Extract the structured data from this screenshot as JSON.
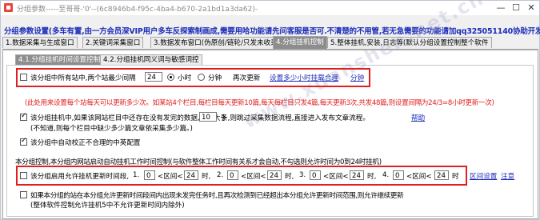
{
  "window": {
    "title": "分组参数-----至哥哥-'0'--(6c8946b4-f95c-4ba4-b670-2a1bd1a3da62)-",
    "buttons": {
      "minimize": "—",
      "maximize": "☐",
      "close": "✕"
    }
  },
  "banner": "分组参数设置(多车有置,由一方会员深VIP用户多车反探索制画成,需要用哈功能请先问客服是否可.不清楚的不用管,若无急需要的功能请加qq325051140协助开发)",
  "tabs_main": [
    {
      "label": "1.数据采集与生成窗口"
    },
    {
      "label": "2.关键词采集窗口"
    },
    {
      "label": "3.数据发布窗口(伪原创/链轮/只发未收录"
    },
    {
      "label": "4.分组挂机控制"
    },
    {
      "label": "5.整体挂机,安装,日志等(默认分组设置控制整个软件"
    }
  ],
  "tabs_sub": [
    {
      "label": "4.1.分组挂机时间设置控制"
    },
    {
      "label": "4.2.分组挂机同义词与敏感词控"
    }
  ],
  "row1": {
    "label": "该分组中所有站中,两个站最少间隔",
    "interval_value": "24",
    "radio_hour": "小时",
    "radio_minute": "分钟",
    "update_text": "再次更新",
    "link_set": "设置多少小时挂载合理",
    "link_minute": "分钟"
  },
  "red_note": "(此处用来设置每个站每天可以更新多少次。如某站4个栏目,每栏目每天更新10篇,每天每栏目只发4篇,每天更新3次,共发48篇,则设置间隔为24/3=8小时更新一次)",
  "row2": {
    "label": "该分组挂机中,如果该网站栏目中还存在没有发完的数据,当数大于",
    "count_value": "10",
    "label2": "条,则跳过采集数据流程,直接进入发布文章流程。",
    "help_link": "帮助",
    "note": "(不知道,则每个栏目中缺少多少篇文章依采集多少篇。)"
  },
  "row3": {
    "label": "该分组中自动校正不合理的中英配置"
  },
  "schedule_title": "本分组控制,本分组内网站启动自动挂机工作时间控制(与软件整体工作时间有关系才会自动,不勾选则允许时间为0到24时挂机)",
  "row4": {
    "label": "该分组启用允许挂机更新时间段,",
    "ranges": [
      {
        "index": "1.",
        "from": "0",
        "between": "<区间<",
        "to": "24",
        "unit": "时,"
      },
      {
        "index": "2.",
        "from": "0",
        "between": "<区间<",
        "to": "24",
        "unit": "时,"
      },
      {
        "index": "3.",
        "from": "0",
        "between": "<区间<",
        "to": "24",
        "unit": "时,"
      },
      {
        "index": "4.",
        "from": "0",
        "between": "<区间<",
        "to": "24",
        "unit": "时"
      }
    ],
    "link_reset": "区间设置",
    "link_note": "注意"
  },
  "row5": {
    "label": "如果本分组的站在本分组允许更新时间段间内出现未发完任务时,且再次检测到已经超出本分组允许更新时间范围,则允许继续更新",
    "note": "(整体软件控制允许挂机5中不允许更新时间内除外)"
  },
  "watermark": "www.xuanshen.net.cn",
  "colors": {
    "accent_blue": "#1c2db8",
    "highlight_red": "#e02020",
    "tab_active": "#8d8d8d"
  }
}
